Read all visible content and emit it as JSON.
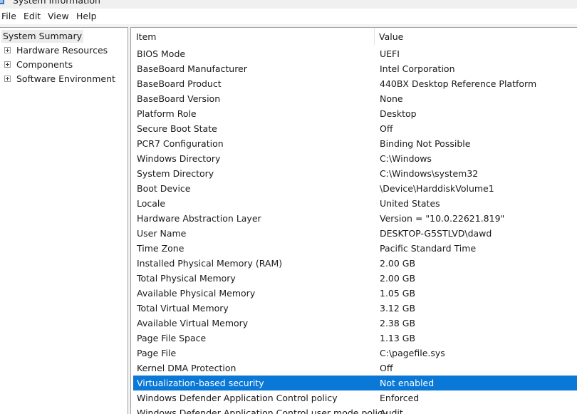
{
  "window": {
    "title": "System Information",
    "icon": "system-information-icon"
  },
  "menu": [
    {
      "label": "File"
    },
    {
      "label": "Edit"
    },
    {
      "label": "View"
    },
    {
      "label": "Help"
    }
  ],
  "tree": {
    "root": "System Summary",
    "nodes": [
      {
        "label": "Hardware Resources",
        "icon": "plus-expand-icon"
      },
      {
        "label": "Components",
        "icon": "plus-expand-icon"
      },
      {
        "label": "Software Environment",
        "icon": "plus-expand-icon"
      }
    ]
  },
  "table": {
    "headers": [
      "Item",
      "Value"
    ],
    "rows": [
      {
        "item": "BIOS Mode",
        "value": "UEFI"
      },
      {
        "item": "BaseBoard Manufacturer",
        "value": "Intel Corporation"
      },
      {
        "item": "BaseBoard Product",
        "value": "440BX Desktop Reference Platform"
      },
      {
        "item": "BaseBoard Version",
        "value": "None"
      },
      {
        "item": "Platform Role",
        "value": "Desktop"
      },
      {
        "item": "Secure Boot State",
        "value": "Off"
      },
      {
        "item": "PCR7 Configuration",
        "value": "Binding Not Possible"
      },
      {
        "item": "Windows Directory",
        "value": "C:\\Windows"
      },
      {
        "item": "System Directory",
        "value": "C:\\Windows\\system32"
      },
      {
        "item": "Boot Device",
        "value": "\\Device\\HarddiskVolume1"
      },
      {
        "item": "Locale",
        "value": "United States"
      },
      {
        "item": "Hardware Abstraction Layer",
        "value": "Version = \"10.0.22621.819\""
      },
      {
        "item": "User Name",
        "value": "DESKTOP-G5STLVD\\dawd"
      },
      {
        "item": "Time Zone",
        "value": "Pacific Standard Time"
      },
      {
        "item": "Installed Physical Memory (RAM)",
        "value": "2.00 GB"
      },
      {
        "item": "Total Physical Memory",
        "value": "2.00 GB"
      },
      {
        "item": "Available Physical Memory",
        "value": "1.05 GB"
      },
      {
        "item": "Total Virtual Memory",
        "value": "3.12 GB"
      },
      {
        "item": "Available Virtual Memory",
        "value": "2.38 GB"
      },
      {
        "item": "Page File Space",
        "value": "1.13 GB"
      },
      {
        "item": "Page File",
        "value": "C:\\pagefile.sys"
      },
      {
        "item": "Kernel DMA Protection",
        "value": "Off"
      },
      {
        "item": "Virtualization-based security",
        "value": "Not enabled",
        "selected": true
      },
      {
        "item": "Windows Defender Application Control policy",
        "value": "Enforced"
      },
      {
        "item": "Windows Defender Application Control user mode policy",
        "value": "Audit"
      }
    ]
  },
  "colors": {
    "selection": "#0a78d7",
    "selection_text": "#ffffff",
    "pane_border": "#a0a0a0",
    "tree_root_highlight": "#ececec"
  }
}
